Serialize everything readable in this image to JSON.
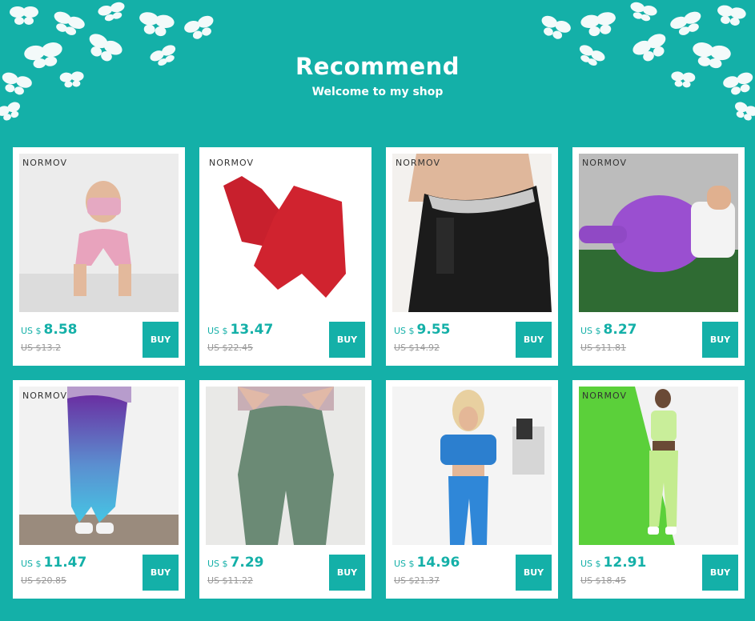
{
  "header": {
    "title": "Recommend",
    "subtitle": "Welcome to my shop"
  },
  "colors": {
    "accent": "#14b0a8",
    "card": "#ffffff"
  },
  "products": [
    {
      "brand": "NORMOV",
      "currency": "US $",
      "price": "8.58",
      "old_price": "US $13.2",
      "buy_label": "BUY",
      "image": "pink-shorts-set-photo"
    },
    {
      "brand": "NORMOV",
      "currency": "US $",
      "price": "13.47",
      "old_price": "US $22.45",
      "buy_label": "BUY",
      "image": "red-bra-shorts-photo"
    },
    {
      "brand": "NORMOV",
      "currency": "US $",
      "price": "9.55",
      "old_price": "US $14.92",
      "buy_label": "BUY",
      "image": "sauna-waist-pants-photo"
    },
    {
      "brand": "NORMOV",
      "currency": "US $",
      "price": "8.27",
      "old_price": "US $11.81",
      "buy_label": "BUY",
      "image": "purple-shorts-photo"
    },
    {
      "brand": "NORMOV",
      "currency": "US $",
      "price": "11.47",
      "old_price": "US $20.85",
      "buy_label": "BUY",
      "image": "gradient-leggings-photo"
    },
    {
      "brand": "",
      "currency": "US $",
      "price": "7.29",
      "old_price": "US $11.22",
      "buy_label": "BUY",
      "image": "green-leggings-photo"
    },
    {
      "brand": "",
      "currency": "US $",
      "price": "14.96",
      "old_price": "US $21.37",
      "buy_label": "BUY",
      "image": "blue-crop-set-photo"
    },
    {
      "brand": "NORMOV",
      "currency": "US $",
      "price": "12.91",
      "old_price": "US $18.45",
      "buy_label": "BUY",
      "image": "lime-set-photo"
    }
  ]
}
